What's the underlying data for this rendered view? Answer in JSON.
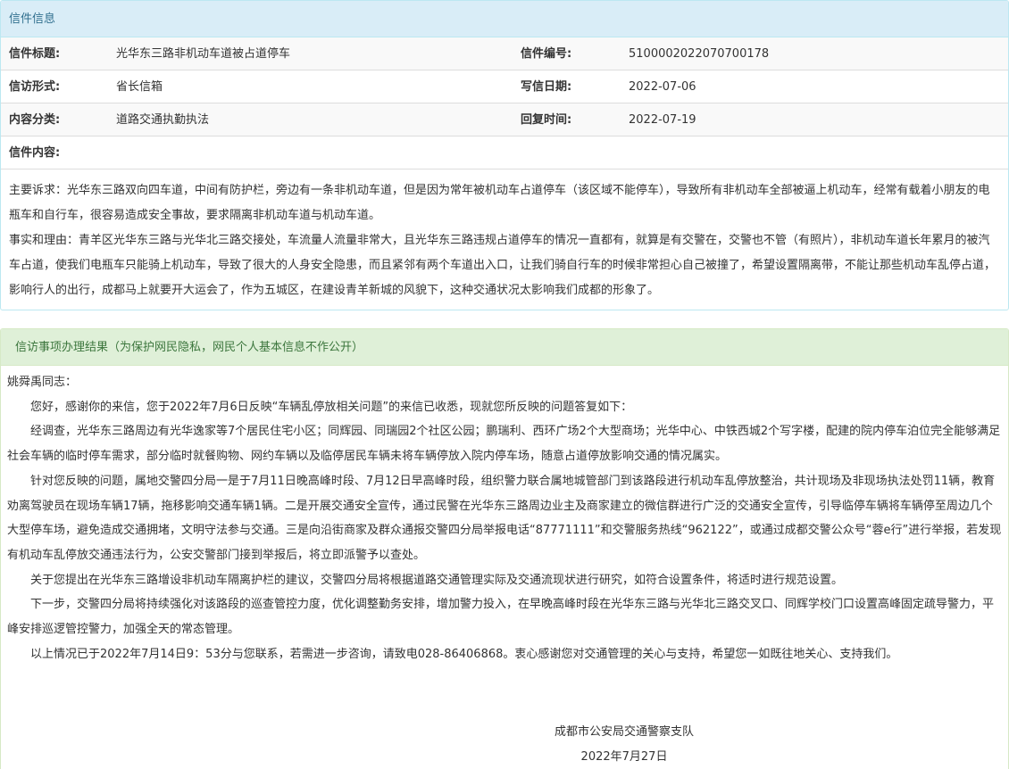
{
  "letter_panel": {
    "title": "信件信息",
    "rows": [
      {
        "label1": "信件标题:",
        "value1": "光华东三路非机动车道被占道停车",
        "label2": "信件编号:",
        "value2": "5100002022070700178"
      },
      {
        "label1": "信访形式:",
        "value1": "省长信箱",
        "label2": "写信日期:",
        "value2": "2022-07-06"
      },
      {
        "label1": "内容分类:",
        "value1": "道路交通执勤执法",
        "label2": "回复时间:",
        "value2": "2022-07-19"
      }
    ],
    "content_label": "信件内容:",
    "content_paragraphs": [
      "主要诉求：光华东三路双向四车道，中间有防护栏，旁边有一条非机动车道，但是因为常年被机动车占道停车（该区域不能停车），导致所有非机动车全部被逼上机动车，经常有载着小朋友的电瓶车和自行车，很容易造成安全事故，要求隔离非机动车道与机动车道。",
      "事实和理由：青羊区光华东三路与光华北三路交接处，车流量人流量非常大，且光华东三路违规占道停车的情况一直都有，就算是有交警在，交警也不管（有照片），非机动车道长年累月的被汽车占道，使我们电瓶车只能骑上机动车，导致了很大的人身安全隐患，而且紧邻有两个车道出入口，让我们骑自行车的时候非常担心自己被撞了，希望设置隔离带，不能让那些机动车乱停占道，影响行人的出行，成都马上就要开大运会了，作为五城区，在建设青羊新城的风貌下，这种交通状况太影响我们成都的形象了。"
    ]
  },
  "reply_panel": {
    "title": "信访事项办理结果（为保护网民隐私，网民个人基本信息不作公开）",
    "salutation": "姚舜禹同志：",
    "paragraphs": [
      "您好，感谢你的来信，您于2022年7月6日反映“车辆乱停放相关问题”的来信已收悉，现就您所反映的问题答复如下：",
      "经调查，光华东三路周边有光华逸家等7个居民住宅小区；同辉园、同瑞园2个社区公园；鹏瑞利、西环广场2个大型商场；光华中心、中铁西城2个写字楼，配建的院内停车泊位完全能够满足社会车辆的临时停车需求，部分临时就餐购物、网约车辆以及临停居民车辆未将车辆停放入院内停车场，随意占道停放影响交通的情况属实。",
      "针对您反映的问题，属地交警四分局一是于7月11日晚高峰时段、7月12日早高峰时段，组织警力联合属地城管部门到该路段进行机动车乱停放整治，共计现场及非现场执法处罚11辆，教育劝离驾驶员在现场车辆17辆，拖移影响交通车辆1辆。二是开展交通安全宣传，通过民警在光华东三路周边业主及商家建立的微信群进行广泛的交通安全宣传，引导临停车辆将车辆停至周边几个大型停车场，避免造成交通拥堵，文明守法参与交通。三是向沿街商家及群众通报交警四分局举报电话“87771111”和交警服务热线“962122”，或通过成都交警公众号“蓉e行”进行举报，若发现有机动车乱停放交通违法行为，公安交警部门接到举报后，将立即派警予以查处。",
      "关于您提出在光华东三路增设非机动车隔离护栏的建议，交警四分局将根据道路交通管理实际及交通流现状进行研究，如符合设置条件，将适时进行规范设置。",
      "下一步，交警四分局将持续强化对该路段的巡查管控力度，优化调整勤务安排，增加警力投入，在早晚高峰时段在光华东三路与光华北三路交叉口、同辉学校门口设置高峰固定疏导警力，平峰安排巡逻管控警力，加强全天的常态管理。",
      "以上情况已于2022年7月14日9：53分与您联系，若需进一步咨询，请致电028-86406868。衷心感谢您对交通管理的关心与支持，希望您一如既往地关心、支持我们。"
    ],
    "signature_org": "成都市公安局交通警察支队",
    "signature_date": "2022年7月27日"
  },
  "colors": {
    "info_heading_bg": "#d9edf7",
    "info_heading_text": "#31708f",
    "success_heading_bg": "#dff0d8",
    "success_heading_text": "#3c763d"
  }
}
